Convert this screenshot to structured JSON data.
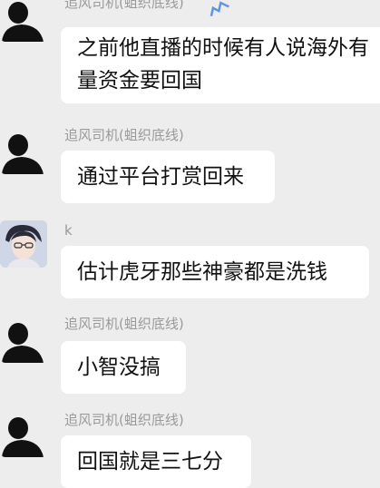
{
  "messages": [
    {
      "sender": "追风司机(蛆织底线)",
      "text_lines": [
        "之前他直播的时候有人说海外有",
        "量资金要回国"
      ],
      "avatar": "silhouette-avatar-icon"
    },
    {
      "sender": "追风司机(蛆织底线)",
      "text": "通过平台打赏回来",
      "avatar": "silhouette-avatar-icon"
    },
    {
      "sender": "k",
      "text": "估计虎牙那些神豪都是洗钱",
      "avatar": "anime-boy-avatar-icon"
    },
    {
      "sender": "追风司机(蛆织底线)",
      "text": "小智没搞",
      "avatar": "silhouette-avatar-icon"
    },
    {
      "sender": "追风司机(蛆织底线)",
      "text": "回国就是三七分",
      "avatar": "silhouette-avatar-icon"
    }
  ],
  "colors": {
    "background": "#ededed",
    "bubble": "#ffffff",
    "sender_name": "#9a9a9a",
    "message_text": "#111111",
    "watermark": "#2a6fe0"
  }
}
